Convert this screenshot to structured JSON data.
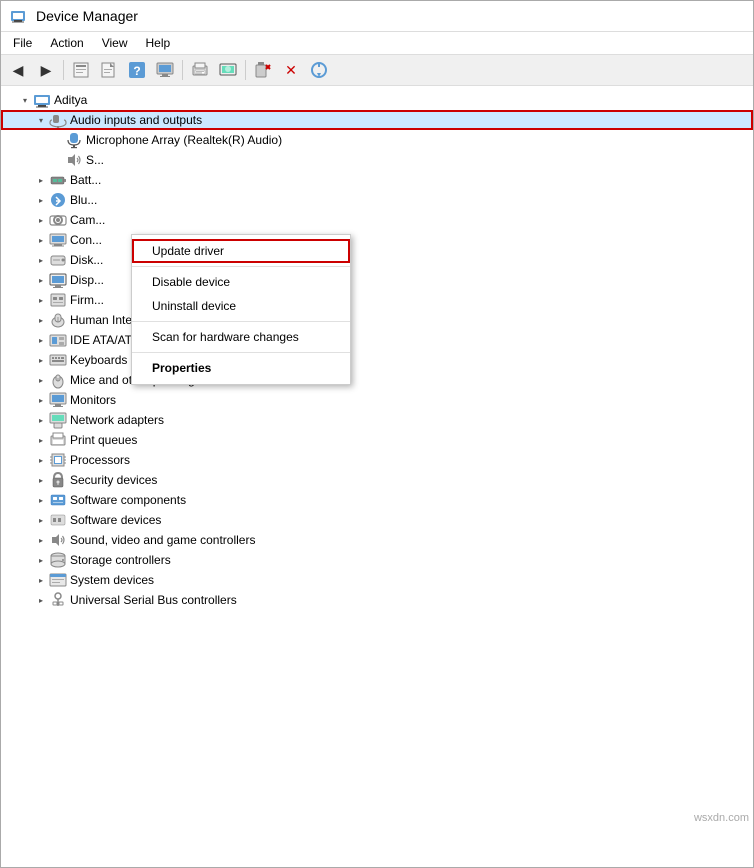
{
  "titleBar": {
    "title": "Device Manager",
    "icon": "device-manager-icon"
  },
  "menuBar": {
    "items": [
      "File",
      "Action",
      "View",
      "Help"
    ]
  },
  "toolbar": {
    "buttons": [
      {
        "name": "back-btn",
        "icon": "◀",
        "label": "Back"
      },
      {
        "name": "forward-btn",
        "icon": "▶",
        "label": "Forward"
      },
      {
        "name": "properties-btn",
        "icon": "🗒",
        "label": "Properties"
      },
      {
        "name": "update-driver-btn",
        "icon": "📄",
        "label": "Update Driver"
      },
      {
        "name": "help-btn",
        "icon": "❓",
        "label": "Help"
      },
      {
        "name": "display-btn",
        "icon": "🖥",
        "label": "Display"
      },
      {
        "name": "print-btn",
        "icon": "🖨",
        "label": "Print"
      },
      {
        "name": "monitor-btn",
        "icon": "🖥",
        "label": "Monitor"
      },
      {
        "name": "remove-btn",
        "icon": "🔧",
        "label": "Remove"
      },
      {
        "name": "delete-btn",
        "icon": "✕",
        "label": "Delete",
        "color": "red"
      },
      {
        "name": "scan-btn",
        "icon": "⊕",
        "label": "Scan for hardware"
      }
    ]
  },
  "tree": {
    "root": {
      "label": "Aditya",
      "expanded": true,
      "children": [
        {
          "label": "Audio inputs and outputs",
          "highlighted": true,
          "expanded": true,
          "children": [
            {
              "label": "Microphone Array (Realtek(R) Audio)"
            },
            {
              "label": "Speakers"
            }
          ]
        },
        {
          "label": "Batteries",
          "collapsed": true
        },
        {
          "label": "Bluetooth",
          "collapsed": true
        },
        {
          "label": "Cameras",
          "collapsed": true
        },
        {
          "label": "Computer",
          "collapsed": true
        },
        {
          "label": "Disk drives",
          "collapsed": true
        },
        {
          "label": "Display adapters",
          "collapsed": true
        },
        {
          "label": "Firmware",
          "collapsed": true
        },
        {
          "label": "Human Interface Devices",
          "collapsed": true
        },
        {
          "label": "IDE ATA/ATAPI controllers",
          "collapsed": true
        },
        {
          "label": "Keyboards",
          "collapsed": true
        },
        {
          "label": "Mice and other pointing devices",
          "collapsed": true
        },
        {
          "label": "Monitors",
          "collapsed": true
        },
        {
          "label": "Network adapters",
          "collapsed": true
        },
        {
          "label": "Print queues",
          "collapsed": true
        },
        {
          "label": "Processors",
          "collapsed": true
        },
        {
          "label": "Security devices",
          "collapsed": true
        },
        {
          "label": "Software components",
          "collapsed": true
        },
        {
          "label": "Software devices",
          "collapsed": true
        },
        {
          "label": "Sound, video and game controllers",
          "collapsed": true
        },
        {
          "label": "Storage controllers",
          "collapsed": true
        },
        {
          "label": "System devices",
          "collapsed": true
        },
        {
          "label": "Universal Serial Bus controllers",
          "collapsed": true
        }
      ]
    }
  },
  "contextMenu": {
    "items": [
      {
        "label": "Update driver",
        "action": "update-driver",
        "highlighted": true
      },
      {
        "label": "Disable device",
        "action": "disable"
      },
      {
        "label": "Uninstall device",
        "action": "uninstall"
      },
      {
        "label": "Scan for hardware changes",
        "action": "scan"
      },
      {
        "label": "Properties",
        "action": "properties",
        "bold": true
      }
    ]
  },
  "watermark": "wsxdn.com"
}
